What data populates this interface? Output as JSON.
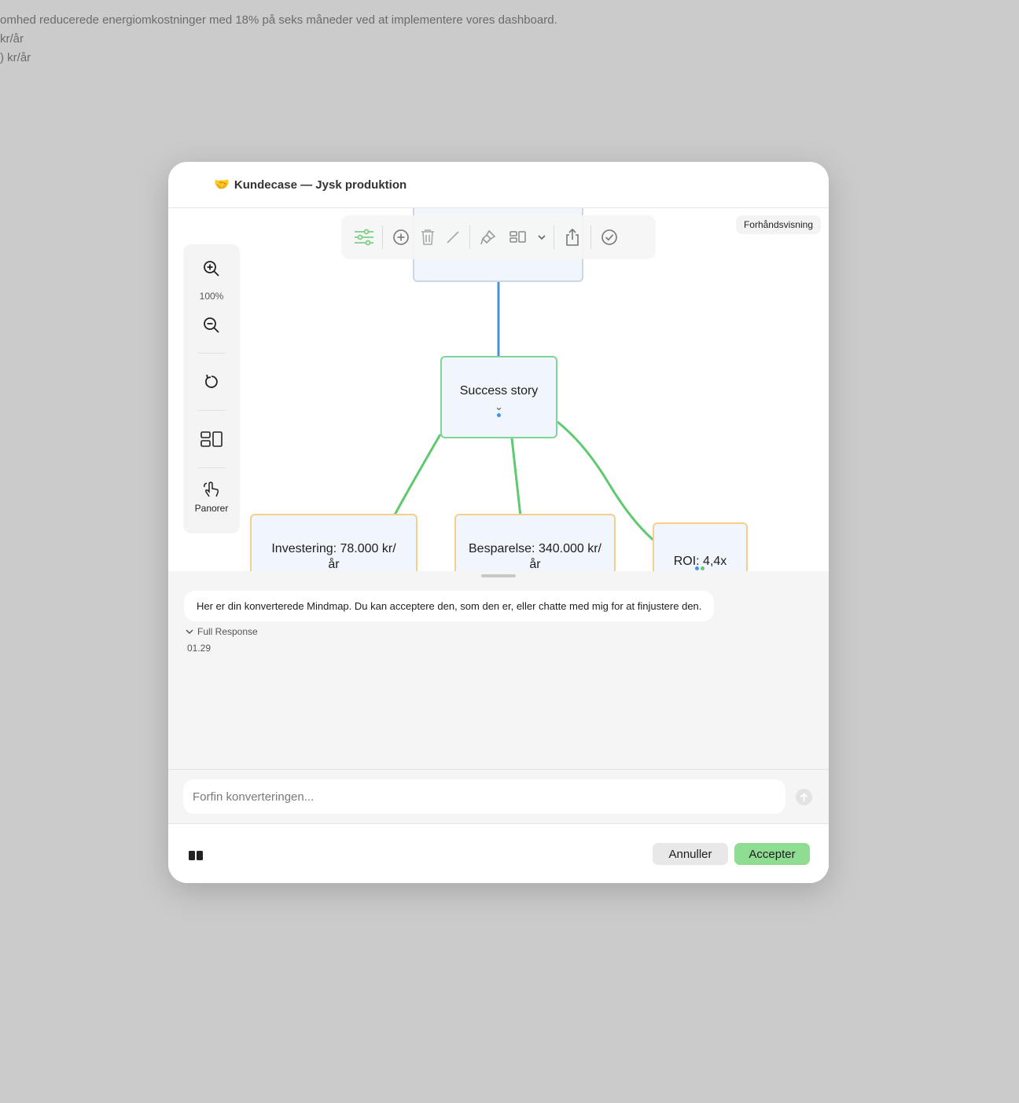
{
  "background": {
    "lines": [
      "omhed reducerede energiomkostninger med 18% på seks måneder ved at implementere vores dashboard.",
      "kr/år",
      ") kr/år"
    ]
  },
  "modal": {
    "title_emoji": "🤝",
    "title": "Kundecase — Jysk produktion"
  },
  "canvas": {
    "preview_badge": "Forhåndsvisning",
    "zoom_level": "100%",
    "pan_label": "Panorer",
    "nodes": {
      "success": "Success story",
      "investering": "Investering: 78.000 kr/år",
      "besparelse": "Besparelse: 340.000 kr/år",
      "roi": "ROI: 4,4x"
    },
    "colors": {
      "root_edge": "#4a90d9",
      "child_edge": "#5ec96f",
      "success_border": "#7ed69a",
      "leaf_border": "#f5cf8e",
      "node_fill": "#f1f6fc"
    },
    "toolbar_icons": [
      "sliders-icon",
      "add-circle-icon",
      "trash-icon",
      "pencil-icon",
      "brush-icon",
      "layout-icon",
      "chevron-down-icon",
      "share-icon",
      "checkmark-circle-icon"
    ],
    "side_icons": [
      "zoom-in-icon",
      "zoom-out-icon",
      "reset-icon",
      "layout-icon",
      "hand-icon"
    ]
  },
  "chat": {
    "message": "Her er din konverterede Mindmap. Du kan acceptere den, som den er, eller chatte med mig for at finjustere den.",
    "full_response_label": "Full Response",
    "timestamp": "01.29"
  },
  "input": {
    "placeholder": "Forfin konverteringen...",
    "value": ""
  },
  "footer": {
    "cancel_label": "Annuller",
    "accept_label": "Accepter",
    "accent_color": "#8fdc93"
  }
}
